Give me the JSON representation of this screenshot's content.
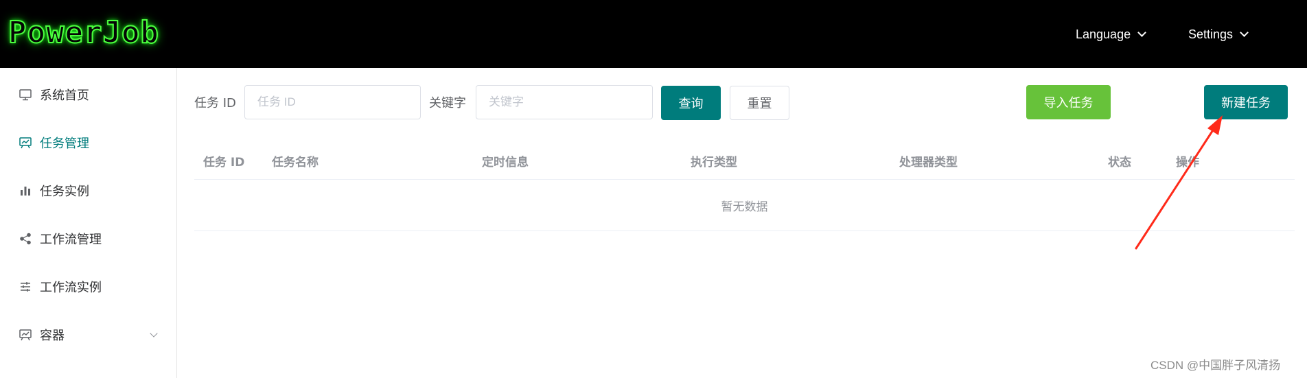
{
  "header": {
    "logo_text": "PowerJob",
    "language_label": "Language",
    "settings_label": "Settings"
  },
  "sidebar": {
    "items": [
      {
        "label": "系统首页",
        "icon": "monitor-icon"
      },
      {
        "label": "任务管理",
        "icon": "presentation-icon",
        "active": true
      },
      {
        "label": "任务实例",
        "icon": "bar-chart-icon"
      },
      {
        "label": "工作流管理",
        "icon": "share-icon"
      },
      {
        "label": "工作流实例",
        "icon": "sliders-icon"
      },
      {
        "label": "容器",
        "icon": "presentation-icon",
        "has_submenu": true
      }
    ]
  },
  "search": {
    "task_id_label": "任务 ID",
    "task_id_placeholder": "任务 ID",
    "keyword_label": "关键字",
    "keyword_placeholder": "关键字",
    "query_button": "查询",
    "reset_button": "重置",
    "import_button": "导入任务",
    "new_button": "新建任务"
  },
  "table": {
    "columns": [
      "任务 ID",
      "任务名称",
      "定时信息",
      "执行类型",
      "处理器类型",
      "状态",
      "操作"
    ],
    "empty_text": "暂无数据"
  },
  "watermark": "CSDN @中国胖子风清扬",
  "colors": {
    "primary": "#007C7C",
    "success": "#67c23a",
    "header_bg": "#000000",
    "logo_glow": "#4cff3f",
    "annotation_arrow": "#ff2a1a"
  }
}
